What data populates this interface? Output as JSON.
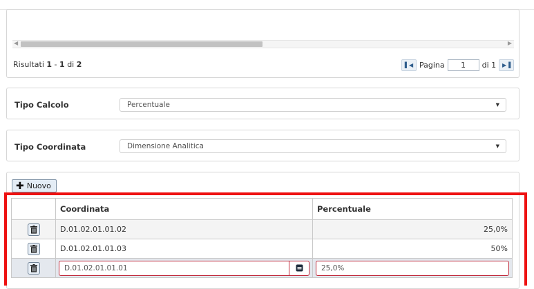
{
  "results": {
    "prefix": "Risultati",
    "start": "1",
    "sep": "-",
    "end": "1",
    "of": "di",
    "total": "2"
  },
  "pager": {
    "page_label": "Pagina",
    "page_value": "1",
    "of_pages": "di 1"
  },
  "tipo_calcolo": {
    "label": "Tipo Calcolo",
    "value": "Percentuale"
  },
  "tipo_coordinata": {
    "label": "Tipo Coordinata",
    "value": "Dimensione Analitica"
  },
  "new_button": {
    "label": "Nuovo"
  },
  "grid": {
    "headers": [
      "Coordinata",
      "Percentuale"
    ],
    "rows": [
      {
        "coordinata": "D.01.02.01.01.02",
        "percentuale": "25,0%"
      },
      {
        "coordinata": "D.01.02.01.01.03",
        "percentuale": "50%"
      }
    ],
    "edit_row": {
      "coordinata": "D.01.02.01.01.01",
      "percentuale": "25,0%"
    }
  },
  "colors": {
    "highlight": "#ee1111",
    "button_bg": "#e3ecf5",
    "error_border": "#c02a3b"
  }
}
